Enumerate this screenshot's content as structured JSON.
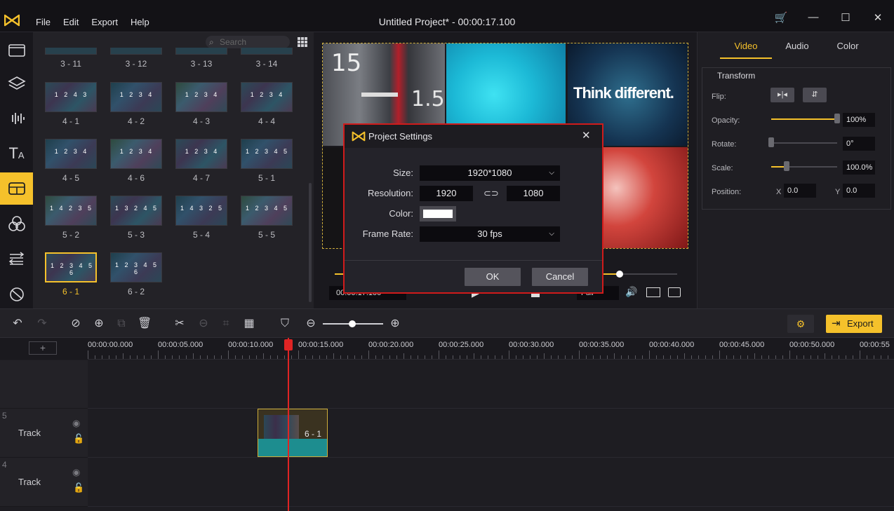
{
  "app": {
    "title": "Untitled Project* - 00:00:17.100",
    "menu": [
      "File",
      "Edit",
      "Export",
      "Help"
    ],
    "accent": "#f5c12b"
  },
  "library": {
    "search_placeholder": "Search",
    "top_labels": [
      "3 - 11",
      "3 - 12",
      "3 - 13",
      "3 - 14"
    ],
    "items": [
      {
        "label": "4 - 1",
        "nums": "1 2 4 3"
      },
      {
        "label": "4 - 2",
        "nums": "1 2 3 4"
      },
      {
        "label": "4 - 3",
        "nums": "1 2 3 4"
      },
      {
        "label": "4 - 4",
        "nums": "1 2 3 4"
      },
      {
        "label": "4 - 5",
        "nums": "1 2 3 4"
      },
      {
        "label": "4 - 6",
        "nums": "1 2 3 4"
      },
      {
        "label": "4 - 7",
        "nums": "1 2 3 4"
      },
      {
        "label": "5 - 1",
        "nums": "1 2 3 4 5"
      },
      {
        "label": "5 - 2",
        "nums": "1 4 2 3 5"
      },
      {
        "label": "5 - 3",
        "nums": "1 3 2 4 5"
      },
      {
        "label": "5 - 4",
        "nums": "1 4 3 2 5"
      },
      {
        "label": "5 - 5",
        "nums": "1 2 3 4 5"
      },
      {
        "label": "6 - 1",
        "nums": "1 2 3 4 5 6",
        "selected": true
      },
      {
        "label": "6 - 2",
        "nums": "1 2 3 4 5 6"
      }
    ]
  },
  "preview": {
    "overlay_text": "Think different.",
    "meter_numbers": [
      "15",
      "1.5"
    ],
    "timecode": "00:00:17.100",
    "quality": "Full"
  },
  "props": {
    "tabs": [
      "Video",
      "Audio",
      "Color"
    ],
    "active_tab": "Video",
    "section": "Transform",
    "flip_label": "Flip:",
    "opacity_label": "Opacity:",
    "opacity_value": "100%",
    "opacity_level": 1.0,
    "rotate_label": "Rotate:",
    "rotate_value": "0°",
    "scale_label": "Scale:",
    "scale_value": "100.0%",
    "position_label": "Position:",
    "x_label": "X",
    "x_value": "0.0",
    "y_label": "Y",
    "y_value": "0.0"
  },
  "toolbar": {
    "export_label": "Export"
  },
  "timeline": {
    "ruler": [
      "00:00:00.000",
      "00:00:05.000",
      "00:00:10.000",
      "00:00:15.000",
      "00:00:20.000",
      "00:00:25.000",
      "00:00:30.000",
      "00:00:35.000",
      "00:00:40.000",
      "00:00:45.000",
      "00:00:50.000",
      "00:00:55"
    ],
    "tracks": [
      {
        "num": "5",
        "label": "Track"
      },
      {
        "num": "4",
        "label": "Track"
      }
    ],
    "clip_label": "6 - 1",
    "add_track": "+"
  },
  "dialog": {
    "title": "Project Settings",
    "size_label": "Size:",
    "size_value": "1920*1080",
    "resolution_label": "Resolution:",
    "res_w": "1920",
    "res_h": "1080",
    "color_label": "Color:",
    "framerate_label": "Frame Rate:",
    "framerate_value": "30 fps",
    "ok": "OK",
    "cancel": "Cancel"
  }
}
